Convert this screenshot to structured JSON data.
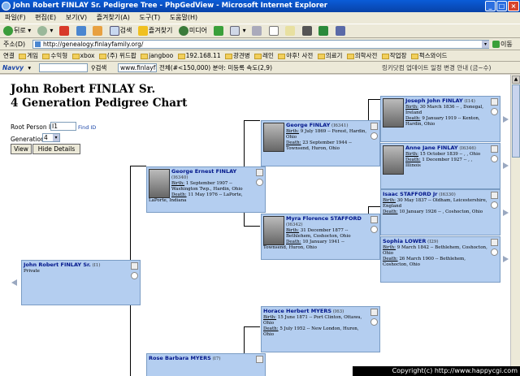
{
  "window": {
    "title": "John Robert FINLAY Sr. Pedigree Tree - PhpGedView - Microsoft Internet Explorer"
  },
  "menu": [
    "파일(F)",
    "편집(E)",
    "보기(V)",
    "즐겨찾기(A)",
    "도구(T)",
    "도움말(H)"
  ],
  "toolbar": {
    "back": "뒤로",
    "search": "검색",
    "favorites": "즐겨찾기",
    "media": "미디어"
  },
  "address": {
    "label": "주소(D)",
    "url": "http://genealogy.finlayfamily.org/",
    "go": "이동"
  },
  "links": {
    "label": "연결",
    "items": [
      "게임",
      "수익형",
      "xbox",
      "(주) 위드팝",
      "jangboo",
      "192.168.11",
      "광견병",
      "레인",
      "야후! 사전",
      "의료기",
      "의학사전",
      "작업장",
      "퍽스와이드"
    ]
  },
  "navvy": {
    "logo": "Navvy",
    "search": "검색",
    "field": "www.finlayfa...",
    "status": "전체(#<150,000) 분야: 미등록 속도(2,9)",
    "notice": "링키닷컴 업데이트 일정 변경 안내 (금~수)"
  },
  "page": {
    "title1": "John Robert FINLAY Sr.",
    "title2": "4 Generation Pedigree Chart"
  },
  "form": {
    "root_label": "Root Person ID:",
    "root_value": "I1",
    "find_id": "Find ID",
    "gen_label": "Generations",
    "gen_value": "4",
    "view": "View",
    "hide": "Hide Details"
  },
  "people": {
    "p1": {
      "name": "John Robert FINLAY Sr.",
      "id": "(I1)",
      "line1": "Private"
    },
    "p2": {
      "name": "George Ernest FINLAY",
      "id": "(I6340)",
      "birth_label": "Birth:",
      "birth": "1 September 1907 -- Washington Twp., Hardin, Ohio",
      "death_label": "Death:",
      "death": "11 May 1976 -- LaPorte, LaPorte, Indiana"
    },
    "p3": {
      "name": "Rose Barbara MYERS",
      "id": "(I7)"
    },
    "p4": {
      "name": "George FINLAY",
      "id": "(I6341)",
      "birth_label": "Birth:",
      "birth": "9 July 1869 -- Forest, Hardin, Ohio",
      "death_label": "Death:",
      "death": "23 September 1944 -- Townsend, Huron, Ohio"
    },
    "p5": {
      "name": "Myra Florence STAFFORD",
      "id": "(I6342)",
      "birth_label": "Birth:",
      "birth": "31 December 1877 -- Bethlehem, Coshocton, Ohio",
      "death_label": "Death:",
      "death": "10 January 1941 -- Townsend, Huron, Ohio"
    },
    "p6": {
      "name": "Horace Herbert MYERS",
      "id": "(I63)",
      "birth_label": "Birth:",
      "birth": "15 June 1871 -- Port Clinton, Ottawa, Ohio",
      "death_label": "Death:",
      "death": "5 July 1952 -- New London, Huron, Ohio"
    },
    "p8": {
      "name": "Joseph John FINLAY",
      "id": "(I14)",
      "birth_label": "Birth:",
      "birth": "30 March 1836 -- , Donegal, Ireland",
      "death_label": "Death:",
      "death": "9 January 1919 -- Kenton, Hardin, Ohio"
    },
    "p9": {
      "name": "Anne Jane FINLAY",
      "id": "(I6346)",
      "birth_label": "Birth:",
      "birth": "15 October 1839 -- , , Ohio",
      "death_label": "Death:",
      "death": "1 December 1927 -- , , Illinois"
    },
    "p10": {
      "name": "Isaac STAFFORD Jr",
      "id": "(I6330)",
      "birth_label": "Birth:",
      "birth": "30 May 1837 -- Oldham, Leicestershire, England",
      "death_label": "Death:",
      "death": "10 January 1926 -- , Coshocton, Ohio"
    },
    "p11": {
      "name": "Sophia LOWER",
      "id": "(I29)",
      "birth_label": "Birth:",
      "birth": "9 March 1842 -- Bethlehem, Coshocton, Ohio",
      "death_label": "Death:",
      "death": "26 March 1900 -- Bethlehem, Coshocton, Ohio"
    }
  },
  "copyright": "Copyright(c) http://www.happycgi.com"
}
